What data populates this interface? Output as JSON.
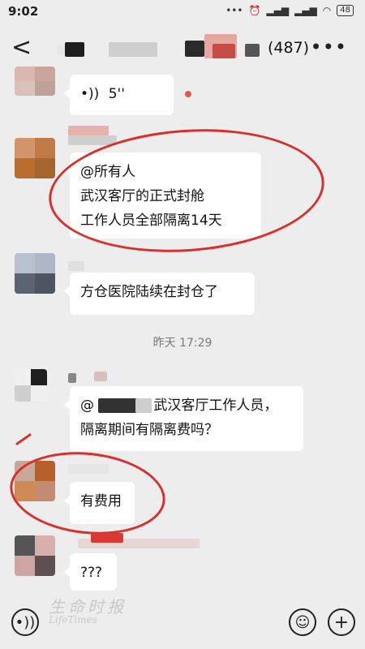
{
  "status_bar": {
    "time": "9:02",
    "battery": "48"
  },
  "header": {
    "member_count": "(487)"
  },
  "messages": [
    {
      "text": "5''"
    },
    {
      "lines": [
        "@所有人",
        "武汉客厅的正式封舱",
        "工作人员全部隔离14天"
      ]
    },
    {
      "text": "方仓医院陆续在封仓了"
    },
    {
      "lines": [
        "@     武汉客厅工作人员，",
        "隔离期间有隔离费吗？"
      ]
    },
    {
      "text": "有费用"
    },
    {
      "text": "???"
    }
  ],
  "timestamp": "昨天 17:29",
  "watermark": {
    "line1": "生命时报",
    "line2": "LifeTimes"
  },
  "colors": {
    "background": "#ededed",
    "bubble": "#ffffff",
    "annotation_red": "#d6312e"
  }
}
